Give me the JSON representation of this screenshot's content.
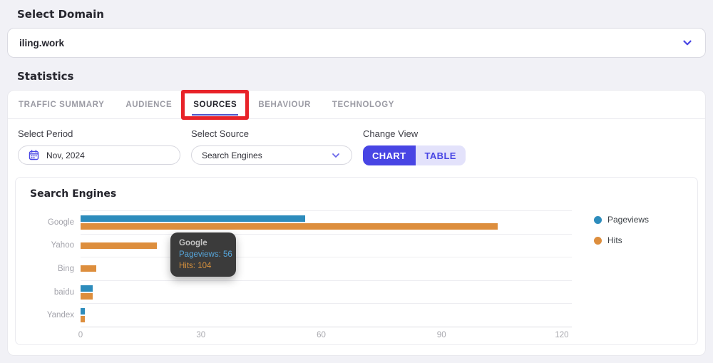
{
  "page": {
    "select_domain_label": "Select Domain",
    "domain_value": "iling.work",
    "statistics_label": "Statistics"
  },
  "tabs": [
    {
      "label": "TRAFFIC SUMMARY",
      "id": "traffic-summary",
      "active": false,
      "annotated": false
    },
    {
      "label": "AUDIENCE",
      "id": "audience",
      "active": false,
      "annotated": false
    },
    {
      "label": "SOURCES",
      "id": "sources",
      "active": true,
      "annotated": true
    },
    {
      "label": "BEHAVIOUR",
      "id": "behaviour",
      "active": false,
      "annotated": false
    },
    {
      "label": "TECHNOLOGY",
      "id": "technology",
      "active": false,
      "annotated": false
    }
  ],
  "filters": {
    "period_label": "Select Period",
    "period_value": "Nov, 2024",
    "source_label": "Select Source",
    "source_value": "Search Engines",
    "view_label": "Change View",
    "chart_button": "CHART",
    "table_button": "TABLE",
    "active_view": "CHART"
  },
  "chart_data": {
    "type": "bar",
    "orientation": "horizontal",
    "title": "Search Engines",
    "categories": [
      "Google",
      "Yahoo",
      "Bing",
      "baidu",
      "Yandex"
    ],
    "series": [
      {
        "name": "Pageviews",
        "color": "#2d8cbc",
        "values": [
          56,
          0,
          0,
          3,
          1
        ]
      },
      {
        "name": "Hits",
        "color": "#dd8e3d",
        "values": [
          104,
          19,
          4,
          3,
          1
        ]
      }
    ],
    "x_ticks": [
      0,
      30,
      60,
      90,
      120
    ],
    "xlim": [
      0,
      122.5
    ],
    "grid": "horizontal-row-lines",
    "legend_position": "right",
    "tooltip": {
      "category": "Google",
      "lines": [
        {
          "label": "Pageviews",
          "value": 56,
          "color": "#56a5da"
        },
        {
          "label": "Hits",
          "value": 104,
          "color": "#d8913c"
        }
      ]
    }
  },
  "colors": {
    "accent_indigo": "#4845e4",
    "accent_indigo_light": "#e3e2fb",
    "tab_underline": "#4d52c8",
    "annotation_red": "#e82329",
    "pageviews_blue": "#2d8cbc",
    "hits_orange": "#dd8e3d",
    "tooltip_bg": "#3b3b3b",
    "page_bg": "#f1f1f6"
  }
}
